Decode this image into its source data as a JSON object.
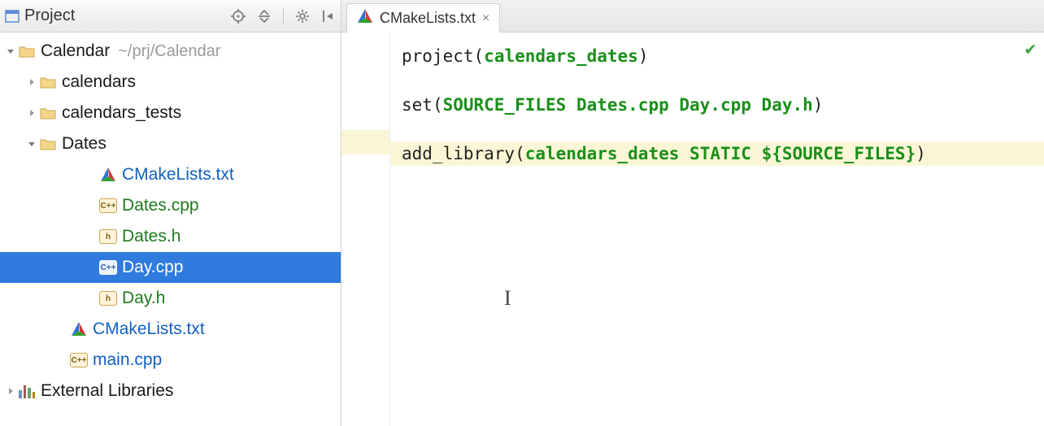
{
  "panel_title": "Project",
  "root": {
    "name": "Calendar",
    "path": "~/prj/Calendar"
  },
  "tree": {
    "calendars": "calendars",
    "calendars_tests": "calendars_tests",
    "dates": "Dates",
    "dates_children": {
      "cmake": "CMakeLists.txt",
      "dates_cpp": "Dates.cpp",
      "dates_h": "Dates.h",
      "day_cpp": "Day.cpp",
      "day_h": "Day.h"
    },
    "root_cmake": "CMakeLists.txt",
    "main_cpp": "main.cpp",
    "ext_libs": "External Libraries"
  },
  "tab": {
    "name": "CMakeLists.txt"
  },
  "code": {
    "l1_fn": "project",
    "l1_arg": "calendars_dates",
    "l3_fn": "set",
    "l3_args": "SOURCE_FILES Dates.cpp Day.cpp Day.h",
    "l5_fn": "add_library",
    "l5_target": "calendars_dates",
    "l5_kw": "STATIC",
    "l5_expr": "${SOURCE_FILES}"
  }
}
